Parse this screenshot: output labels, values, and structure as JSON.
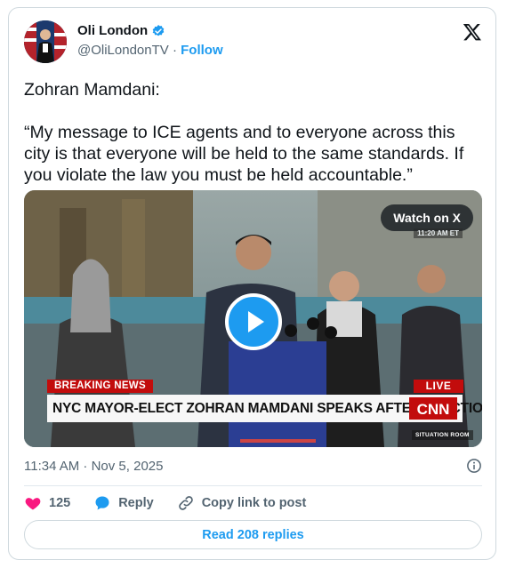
{
  "author": {
    "name": "Oli London",
    "handle": "@OliLondonTV",
    "separator": "·",
    "follow_label": "Follow"
  },
  "tweet": {
    "lines": [
      "Zohran Mamdani:",
      "“My message to ICE agents and to everyone across this city is that everyone will be held to the same standards. If you violate the law you must be held accountable.”"
    ]
  },
  "media": {
    "watch_label": "Watch on X",
    "video_time": "11:20 AM ET",
    "breaking_label": "BREAKING NEWS",
    "live_label": "LIVE",
    "headline": "NYC MAYOR-ELECT ZOHRAN MAMDANI SPEAKS AFTER ELECTION WIN",
    "show_name": "SITUATION ROOM",
    "network_logo": "CNN"
  },
  "meta": {
    "timestamp": "11:34 AM · Nov 5, 2025"
  },
  "actions": {
    "like_count": "125",
    "reply_label": "Reply",
    "copy_label": "Copy link to post"
  },
  "read_replies_label": "Read 208 replies",
  "icons": {
    "verified": "verified-badge-icon",
    "x_logo": "x-logo-icon",
    "info": "info-icon",
    "like": "heart-icon",
    "reply": "speech-bubble-icon",
    "copy": "link-icon",
    "play": "play-icon"
  },
  "colors": {
    "accent": "#1d9bf0",
    "like": "#f91880",
    "breaking_red": "#c20c0c",
    "text_primary": "#0f1419",
    "text_secondary": "#536471"
  }
}
